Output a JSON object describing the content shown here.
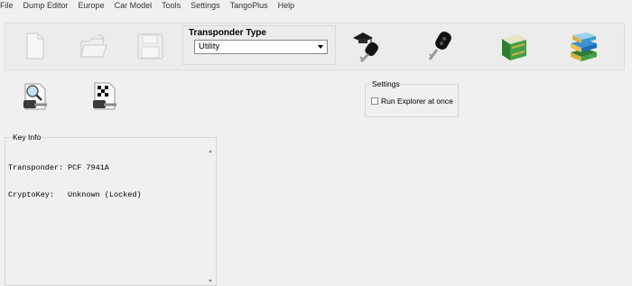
{
  "menu": [
    "File",
    "Dump Editor",
    "Europe",
    "Car Model",
    "Tools",
    "Settings",
    "TangoPlus",
    "Help"
  ],
  "toolbar": {
    "icons": [
      "new-file-icon",
      "open-folder-icon",
      "save-icon",
      "graduate-key-icon",
      "black-car-key-icon",
      "green-book-icon",
      "stacked-books-icon"
    ]
  },
  "transponder": {
    "label": "Transponder Type",
    "selected": "Utility"
  },
  "actions": {
    "icons": [
      "identify-key-icon",
      "race-key-icon"
    ]
  },
  "settings": {
    "title": "Settings",
    "run_explorer_label": "Run Explorer at once",
    "run_explorer_checked": false
  },
  "key_info": {
    "title": "Key Info",
    "rows": [
      {
        "key": "Transponder:",
        "value": "PCF 7941A"
      },
      {
        "key": "CryptoKey:",
        "value": "Unknown (Locked)"
      }
    ]
  },
  "colors": {
    "background": "#f0f0f0",
    "panel_border": "#d6d6d6"
  }
}
